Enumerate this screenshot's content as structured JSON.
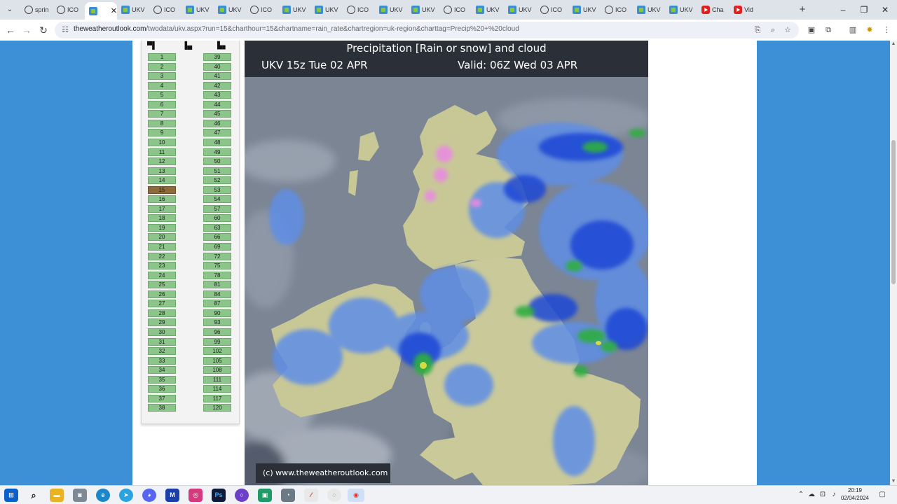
{
  "browser": {
    "tabs": [
      {
        "title": "sprin",
        "icon": "globe"
      },
      {
        "title": "ICO",
        "icon": "globe"
      },
      {
        "title": "",
        "icon": "ukv",
        "active": true
      },
      {
        "title": "UKV",
        "icon": "ukv"
      },
      {
        "title": "ICO",
        "icon": "globe"
      },
      {
        "title": "UKV",
        "icon": "ukv"
      },
      {
        "title": "UKV",
        "icon": "ukv"
      },
      {
        "title": "ICO",
        "icon": "globe"
      },
      {
        "title": "UKV",
        "icon": "ukv"
      },
      {
        "title": "UKV",
        "icon": "ukv"
      },
      {
        "title": "ICO",
        "icon": "globe"
      },
      {
        "title": "UKV",
        "icon": "ukv"
      },
      {
        "title": "UKV",
        "icon": "ukv"
      },
      {
        "title": "ICO",
        "icon": "globe"
      },
      {
        "title": "UKV",
        "icon": "ukv"
      },
      {
        "title": "UKV",
        "icon": "ukv"
      },
      {
        "title": "ICO",
        "icon": "globe"
      },
      {
        "title": "UKV",
        "icon": "ukv"
      },
      {
        "title": "ICO",
        "icon": "globe"
      },
      {
        "title": "UKV",
        "icon": "ukv"
      },
      {
        "title": "UKV",
        "icon": "ukv"
      },
      {
        "title": "Cha",
        "icon": "youtube"
      },
      {
        "title": "Vid",
        "icon": "youtube"
      }
    ],
    "new_tab": "+",
    "window_controls": {
      "minimize": "–",
      "restore": "❐",
      "close": "✕"
    },
    "nav": {
      "back": "←",
      "forward": "→",
      "reload": "↻"
    },
    "url": {
      "host": "theweatheroutlook.com",
      "path": "/twodata/ukv.aspx?run=15&charthour=15&chartname=rain_rate&chartregion=uk-region&charttag=Precip%20+%20cloud"
    }
  },
  "page": {
    "hour_selector": {
      "selected": "15",
      "column1": [
        "1",
        "2",
        "3",
        "4",
        "5",
        "6",
        "7",
        "8",
        "9",
        "10",
        "11",
        "12",
        "13",
        "14",
        "15",
        "16",
        "17",
        "18",
        "19",
        "20",
        "21",
        "22",
        "23",
        "24",
        "25",
        "26",
        "27",
        "28",
        "29",
        "30",
        "31",
        "32",
        "33",
        "34",
        "35",
        "36",
        "37",
        "38"
      ],
      "column2": [
        "39",
        "40",
        "41",
        "42",
        "43",
        "44",
        "45",
        "46",
        "47",
        "48",
        "49",
        "50",
        "51",
        "52",
        "53",
        "54",
        "57",
        "60",
        "63",
        "66",
        "69",
        "72",
        "75",
        "78",
        "81",
        "84",
        "87",
        "90",
        "93",
        "96",
        "99",
        "102",
        "105",
        "108",
        "111",
        "114",
        "117",
        "120"
      ]
    },
    "chart": {
      "title": "Precipitation [Rain or snow] and cloud",
      "run_line": "UKV 15z Tue 02 APR",
      "valid_line": "Valid: 06Z Wed 03 APR",
      "copyright": "(c) www.theweatheroutlook.com"
    }
  },
  "taskbar": {
    "time": "20:19",
    "date": "02/04/2024"
  },
  "colors": {
    "page_background": "#3d8fd6",
    "hour_cell": "#8bc58a",
    "hour_cell_selected": "#8b6a3e",
    "chart_header": "#2b3038",
    "sea_cloud": "#7c8694",
    "land": "#c9c99a",
    "rain_light": "#5f8ee6",
    "rain_moderate": "#1f47d6",
    "rain_heavy": "#2fae3f",
    "snow": "#e98ce0"
  }
}
